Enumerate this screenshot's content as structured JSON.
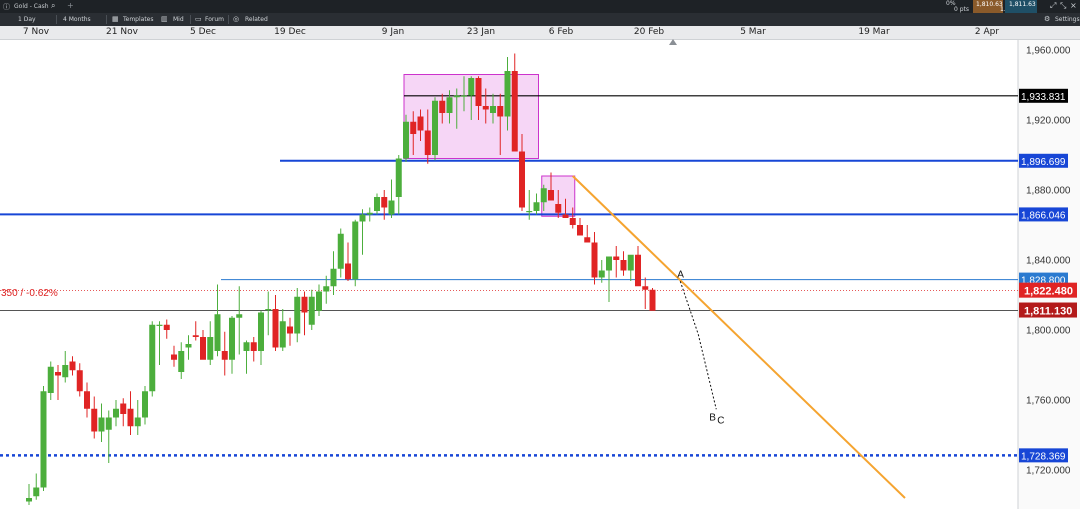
{
  "header": {
    "instrument": "Gold - Cash",
    "change_pct": "0%",
    "change_pts": "0 pts",
    "sell": "1,810.63",
    "spread": "1.00",
    "buy": "1,811.63",
    "add_icon": "plus-icon",
    "search_icon": "search-icon"
  },
  "toolbar": {
    "interval": "1 Day",
    "range": "4 Months",
    "templates": "Templates",
    "price_type": "Mid",
    "forum": "Forum",
    "related": "Related",
    "settings": "Settings"
  },
  "date_axis": [
    "7 Nov",
    "21 Nov",
    "5 Dec",
    "19 Dec",
    "9 Jan",
    "23 Jan",
    "6 Feb",
    "20 Feb",
    "5 Mar",
    "19 Mar",
    "2 Apr"
  ],
  "colors": {
    "up": "#4cae3c",
    "down": "#e02424",
    "blue": "#1746d6",
    "orange": "#f5a430",
    "zone": "#cc33cc"
  },
  "chart_data": {
    "type": "candlestick",
    "ylim": [
      1702,
      1970
    ],
    "y_ticks": [
      "1,960.000",
      "1,920.000",
      "1,880.000",
      "1,840.000",
      "1,800.000",
      "1,760.000",
      "1,720.000"
    ],
    "candles": [
      {
        "o": 1702,
        "h": 1712,
        "l": 1700,
        "c": 1704
      },
      {
        "o": 1705,
        "h": 1718,
        "l": 1703,
        "c": 1710
      },
      {
        "o": 1710,
        "h": 1768,
        "l": 1708,
        "c": 1765
      },
      {
        "o": 1764,
        "h": 1782,
        "l": 1760,
        "c": 1779
      },
      {
        "o": 1776,
        "h": 1780,
        "l": 1760,
        "c": 1774
      },
      {
        "o": 1773,
        "h": 1788,
        "l": 1770,
        "c": 1780
      },
      {
        "o": 1782,
        "h": 1785,
        "l": 1774,
        "c": 1777
      },
      {
        "o": 1777,
        "h": 1781,
        "l": 1762,
        "c": 1765
      },
      {
        "o": 1765,
        "h": 1770,
        "l": 1750,
        "c": 1755
      },
      {
        "o": 1755,
        "h": 1762,
        "l": 1738,
        "c": 1742
      },
      {
        "o": 1742,
        "h": 1758,
        "l": 1736,
        "c": 1750
      },
      {
        "o": 1743,
        "h": 1754,
        "l": 1724,
        "c": 1750
      },
      {
        "o": 1750,
        "h": 1760,
        "l": 1745,
        "c": 1755
      },
      {
        "o": 1758,
        "h": 1761,
        "l": 1745,
        "c": 1752
      },
      {
        "o": 1755,
        "h": 1765,
        "l": 1740,
        "c": 1745
      },
      {
        "o": 1745,
        "h": 1760,
        "l": 1740,
        "c": 1750
      },
      {
        "o": 1750,
        "h": 1768,
        "l": 1746,
        "c": 1765
      },
      {
        "o": 1765,
        "h": 1805,
        "l": 1762,
        "c": 1803
      },
      {
        "o": 1803,
        "h": 1805,
        "l": 1780,
        "c": 1803
      },
      {
        "o": 1803,
        "h": 1806,
        "l": 1795,
        "c": 1800
      },
      {
        "o": 1786,
        "h": 1791,
        "l": 1779,
        "c": 1783
      },
      {
        "o": 1776,
        "h": 1793,
        "l": 1772,
        "c": 1788
      },
      {
        "o": 1790,
        "h": 1797,
        "l": 1783,
        "c": 1792
      },
      {
        "o": 1797,
        "h": 1805,
        "l": 1794,
        "c": 1796
      },
      {
        "o": 1796,
        "h": 1800,
        "l": 1786,
        "c": 1783
      },
      {
        "o": 1783,
        "h": 1805,
        "l": 1780,
        "c": 1796
      },
      {
        "o": 1788,
        "h": 1826,
        "l": 1785,
        "c": 1809
      },
      {
        "o": 1788,
        "h": 1799,
        "l": 1774,
        "c": 1783
      },
      {
        "o": 1783,
        "h": 1808,
        "l": 1775,
        "c": 1807
      },
      {
        "o": 1807,
        "h": 1825,
        "l": 1786,
        "c": 1809
      },
      {
        "o": 1788,
        "h": 1794,
        "l": 1775,
        "c": 1793
      },
      {
        "o": 1793,
        "h": 1796,
        "l": 1782,
        "c": 1788
      },
      {
        "o": 1788,
        "h": 1811,
        "l": 1780,
        "c": 1810
      },
      {
        "o": 1812,
        "h": 1822,
        "l": 1797,
        "c": 1812
      },
      {
        "o": 1812,
        "h": 1820,
        "l": 1788,
        "c": 1790
      },
      {
        "o": 1790,
        "h": 1812,
        "l": 1788,
        "c": 1805
      },
      {
        "o": 1802,
        "h": 1807,
        "l": 1791,
        "c": 1798
      },
      {
        "o": 1798,
        "h": 1824,
        "l": 1793,
        "c": 1819
      },
      {
        "o": 1819,
        "h": 1822,
        "l": 1797,
        "c": 1810
      },
      {
        "o": 1803,
        "h": 1823,
        "l": 1800,
        "c": 1819
      },
      {
        "o": 1811,
        "h": 1826,
        "l": 1808,
        "c": 1822
      },
      {
        "o": 1822,
        "h": 1831,
        "l": 1815,
        "c": 1825
      },
      {
        "o": 1825,
        "h": 1845,
        "l": 1820,
        "c": 1835
      },
      {
        "o": 1835,
        "h": 1858,
        "l": 1830,
        "c": 1855
      },
      {
        "o": 1838,
        "h": 1850,
        "l": 1828,
        "c": 1829
      },
      {
        "o": 1829,
        "h": 1863,
        "l": 1825,
        "c": 1862
      },
      {
        "o": 1862,
        "h": 1869,
        "l": 1843,
        "c": 1866
      },
      {
        "o": 1866,
        "h": 1870,
        "l": 1862,
        "c": 1867
      },
      {
        "o": 1868,
        "h": 1878,
        "l": 1866,
        "c": 1876
      },
      {
        "o": 1876,
        "h": 1880,
        "l": 1863,
        "c": 1870
      },
      {
        "o": 1866,
        "h": 1886,
        "l": 1864,
        "c": 1874
      },
      {
        "o": 1876,
        "h": 1900,
        "l": 1866,
        "c": 1898
      },
      {
        "o": 1898,
        "h": 1923,
        "l": 1896,
        "c": 1919
      },
      {
        "o": 1919,
        "h": 1925,
        "l": 1900,
        "c": 1912
      },
      {
        "o": 1922,
        "h": 1926,
        "l": 1908,
        "c": 1914
      },
      {
        "o": 1914,
        "h": 1926,
        "l": 1895,
        "c": 1900
      },
      {
        "o": 1900,
        "h": 1933,
        "l": 1897,
        "c": 1931
      },
      {
        "o": 1931,
        "h": 1935,
        "l": 1918,
        "c": 1924
      },
      {
        "o": 1924,
        "h": 1937,
        "l": 1918,
        "c": 1933
      },
      {
        "o": 1933,
        "h": 1938,
        "l": 1915,
        "c": 1934
      },
      {
        "o": 1934,
        "h": 1945,
        "l": 1925,
        "c": 1934
      },
      {
        "o": 1934,
        "h": 1945,
        "l": 1920,
        "c": 1944
      },
      {
        "o": 1944,
        "h": 1945,
        "l": 1920,
        "c": 1928
      },
      {
        "o": 1928,
        "h": 1938,
        "l": 1918,
        "c": 1926
      },
      {
        "o": 1924,
        "h": 1935,
        "l": 1918,
        "c": 1928
      },
      {
        "o": 1928,
        "h": 1935,
        "l": 1900,
        "c": 1922
      },
      {
        "o": 1922,
        "h": 1956,
        "l": 1914,
        "c": 1948
      },
      {
        "o": 1948,
        "h": 1958,
        "l": 1906,
        "c": 1902
      },
      {
        "o": 1902,
        "h": 1912,
        "l": 1868,
        "c": 1870
      },
      {
        "o": 1868,
        "h": 1880,
        "l": 1863,
        "c": 1868
      },
      {
        "o": 1868,
        "h": 1878,
        "l": 1866,
        "c": 1873
      },
      {
        "o": 1873,
        "h": 1883,
        "l": 1868,
        "c": 1881
      },
      {
        "o": 1880,
        "h": 1890,
        "l": 1876,
        "c": 1874
      },
      {
        "o": 1872,
        "h": 1880,
        "l": 1864,
        "c": 1867
      },
      {
        "o": 1866,
        "h": 1875,
        "l": 1864,
        "c": 1864
      },
      {
        "o": 1864,
        "h": 1870,
        "l": 1858,
        "c": 1860
      },
      {
        "o": 1860,
        "h": 1864,
        "l": 1857,
        "c": 1854
      },
      {
        "o": 1853,
        "h": 1860,
        "l": 1852,
        "c": 1850
      },
      {
        "o": 1850,
        "h": 1856,
        "l": 1826,
        "c": 1830
      },
      {
        "o": 1830,
        "h": 1840,
        "l": 1827,
        "c": 1834
      },
      {
        "o": 1834,
        "h": 1842,
        "l": 1816,
        "c": 1842
      },
      {
        "o": 1842,
        "h": 1848,
        "l": 1830,
        "c": 1840
      },
      {
        "o": 1840,
        "h": 1845,
        "l": 1831,
        "c": 1834
      },
      {
        "o": 1834,
        "h": 1842,
        "l": 1828,
        "c": 1843
      },
      {
        "o": 1843,
        "h": 1848,
        "l": 1827,
        "c": 1825
      },
      {
        "o": 1825,
        "h": 1830,
        "l": 1812,
        "c": 1823
      },
      {
        "o": 1823,
        "h": 1824,
        "l": 1812,
        "c": 1811
      }
    ],
    "levels": [
      {
        "value": 1933.831,
        "label": "1,933.831",
        "style": "black"
      },
      {
        "value": 1896.699,
        "label": "1,896.699",
        "style": "blue"
      },
      {
        "value": 1866.046,
        "label": "1,866.046",
        "style": "blue"
      },
      {
        "value": 1828.8,
        "label": "1,828.800",
        "style": "lightblue"
      },
      {
        "value": 1728.369,
        "label": "1,728.369",
        "style": "dotted-blue"
      }
    ],
    "current_sell": {
      "value": 1811.13,
      "label": "1,811.130"
    },
    "current_buy": {
      "value": 1822.48,
      "label": "1,822.480"
    },
    "change_note": "350 / -0.62%",
    "annotations": [
      "A",
      "B",
      "C"
    ]
  }
}
